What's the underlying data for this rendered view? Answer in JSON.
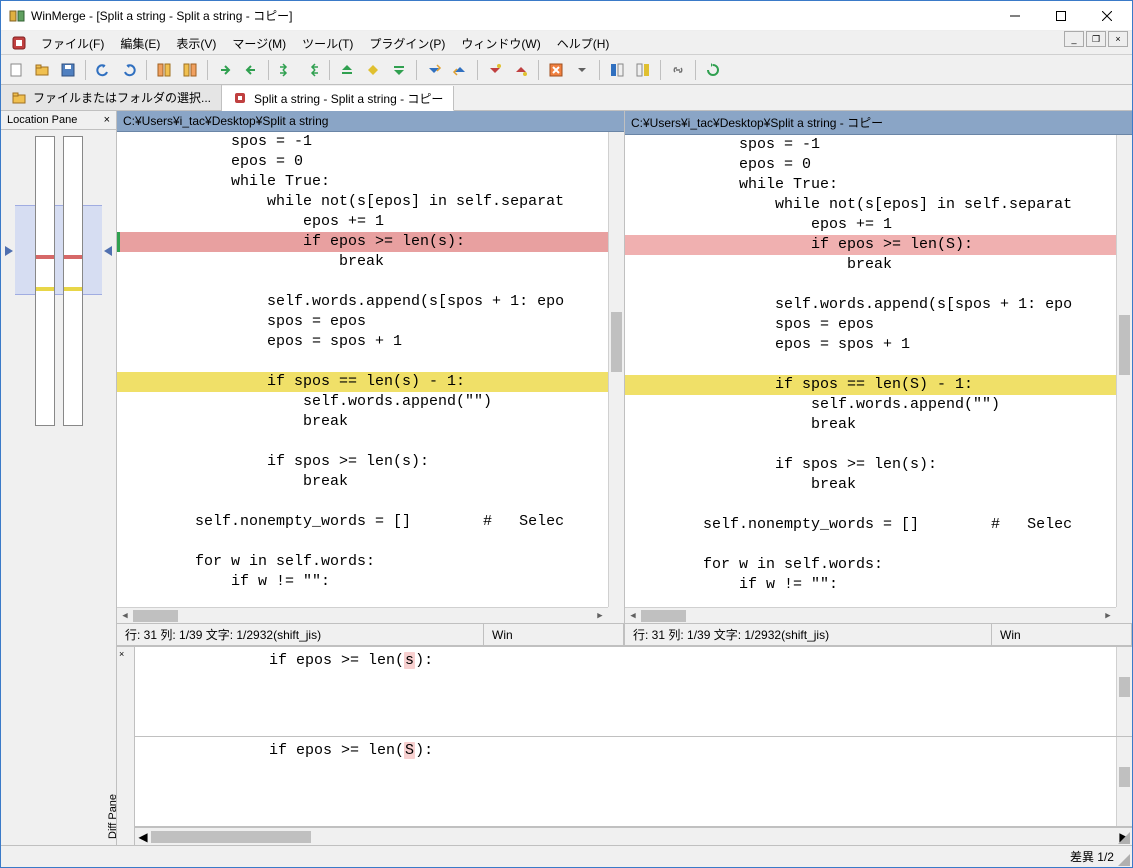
{
  "window_title": "WinMerge - [Split a string - Split a string - コピー]",
  "menubar": [
    "ファイル(F)",
    "編集(E)",
    "表示(V)",
    "マージ(M)",
    "ツール(T)",
    "プラグイン(P)",
    "ウィンドウ(W)",
    "ヘルプ(H)"
  ],
  "doctabs": [
    {
      "label": "ファイルまたはフォルダの選択...",
      "active": false
    },
    {
      "label": "Split a string - Split a string - コピー",
      "active": true
    }
  ],
  "location_pane_title": "Location Pane",
  "panes": {
    "left": {
      "path": "C:¥Users¥i_tac¥Desktop¥Split a string",
      "status_left": "行: 31  列: 1/39  文字: 1/2932(shift_jis)",
      "status_right": "Win"
    },
    "right": {
      "path": "C:¥Users¥i_tac¥Desktop¥Split a string - コピー",
      "status_left": "行: 31  列: 1/39  文字: 1/2932(shift_jis)",
      "status_right": "Win"
    },
    "code_lines": [
      {
        "t": "            spos = -1"
      },
      {
        "t": "            epos = 0"
      },
      {
        "t": "            while True:"
      },
      {
        "t": "                while not(s[epos] in self.separat"
      },
      {
        "t": "                    epos += 1"
      },
      {
        "t": "                    if epos >= len(s):",
        "hl": "redsel",
        "right": "                    if epos >= len(S):"
      },
      {
        "t": "                        break"
      },
      {
        "t": ""
      },
      {
        "t": "                self.words.append(s[spos + 1: epo"
      },
      {
        "t": "                spos = epos"
      },
      {
        "t": "                epos = spos + 1"
      },
      {
        "t": ""
      },
      {
        "t": "                if spos == len(s) - 1:",
        "hl": "yel",
        "right": "                if spos == len(S) - 1:"
      },
      {
        "t": "                    self.words.append(\"\")"
      },
      {
        "t": "                    break"
      },
      {
        "t": ""
      },
      {
        "t": "                if spos >= len(s):"
      },
      {
        "t": "                    break"
      },
      {
        "t": ""
      },
      {
        "t": "        self.nonempty_words = []        #   Selec"
      },
      {
        "t": ""
      },
      {
        "t": "        for w in self.words:"
      },
      {
        "t": "            if w != \"\":"
      }
    ]
  },
  "diff_pane": {
    "label": "Diff Pane",
    "rows": [
      {
        "prefix": "              if epos >= len(",
        "char": "s",
        "suffix": "):"
      },
      {
        "prefix": "              if epos >= len(",
        "char": "S",
        "suffix": "):"
      }
    ]
  },
  "statusbar": "差異 1/2",
  "toolbar_icons": [
    "new-icon",
    "open-icon",
    "save-icon",
    "sep",
    "undo-icon",
    "redo-icon",
    "sep",
    "diff-prev-icon",
    "diff-next-icon",
    "sep",
    "copy-right-icon",
    "copy-left-icon",
    "sep",
    "copy-right-all-icon",
    "copy-left-all-icon",
    "sep",
    "first-diff-icon",
    "current-diff-icon",
    "last-diff-icon",
    "sep",
    "next-diff-icon",
    "prev-diff-icon",
    "sep",
    "next-conf-icon",
    "prev-conf-icon",
    "sep",
    "marker-icon",
    "dropdown-icon",
    "sep",
    "pane1-icon",
    "pane2-icon",
    "sep",
    "link-icon",
    "sep",
    "refresh-icon"
  ]
}
